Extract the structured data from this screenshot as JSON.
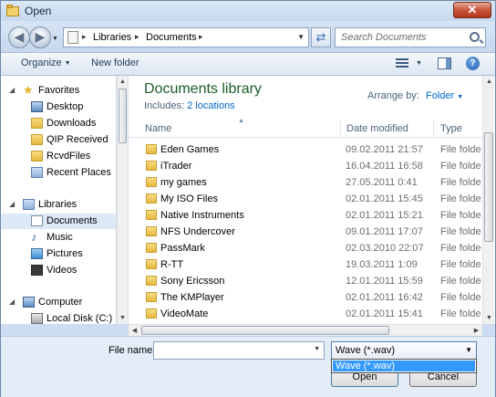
{
  "window": {
    "title": "Open"
  },
  "nav": {
    "breadcrumb": [
      "Libraries",
      "Documents"
    ],
    "search_placeholder": "Search Documents"
  },
  "toolbar": {
    "organize": "Organize",
    "new_folder": "New folder"
  },
  "sidebar": {
    "favorites_header": "Favorites",
    "favorites": [
      "Desktop",
      "Downloads",
      "QIP Received",
      "RcvdFiles",
      "Recent Places"
    ],
    "libraries_header": "Libraries",
    "libraries": [
      "Documents",
      "Music",
      "Pictures",
      "Videos"
    ],
    "computer_header": "Computer",
    "drives": [
      "Local Disk (C:)"
    ]
  },
  "library": {
    "title": "Documents library",
    "includes_label": "Includes:",
    "includes_link": "2 locations",
    "arrange_label": "Arrange by:",
    "arrange_value": "Folder"
  },
  "columns": {
    "name": "Name",
    "date": "Date modified",
    "type": "Type"
  },
  "files": [
    {
      "name": "Eden Games",
      "date": "09.02.2011 21:57",
      "type": "File folde"
    },
    {
      "name": "iTrader",
      "date": "16.04.2011 16:58",
      "type": "File folde"
    },
    {
      "name": "my games",
      "date": "27.05.2011 0:41",
      "type": "File folde"
    },
    {
      "name": "My ISO Files",
      "date": "02.01.2011 15:45",
      "type": "File folde"
    },
    {
      "name": "Native Instruments",
      "date": "02.01.2011 15:21",
      "type": "File folde"
    },
    {
      "name": "NFS Undercover",
      "date": "09.01.2011 17:07",
      "type": "File folde"
    },
    {
      "name": "PassMark",
      "date": "02.03.2010 22:07",
      "type": "File folde"
    },
    {
      "name": "R-TT",
      "date": "19.03.2011 1:09",
      "type": "File folde"
    },
    {
      "name": "Sony Ericsson",
      "date": "12.01.2011 15:59",
      "type": "File folde"
    },
    {
      "name": "The KMPlayer",
      "date": "02.01.2011 16:42",
      "type": "File folde"
    },
    {
      "name": "VideoMate",
      "date": "02.01.2011 15:41",
      "type": "File folde"
    }
  ],
  "footer": {
    "file_name_label": "File name:",
    "file_name_value": "",
    "file_type_value": "Wave (*.wav)",
    "dropdown_option": "Wave (*.wav)",
    "open_label": "Open",
    "cancel_label": "Cancel"
  }
}
